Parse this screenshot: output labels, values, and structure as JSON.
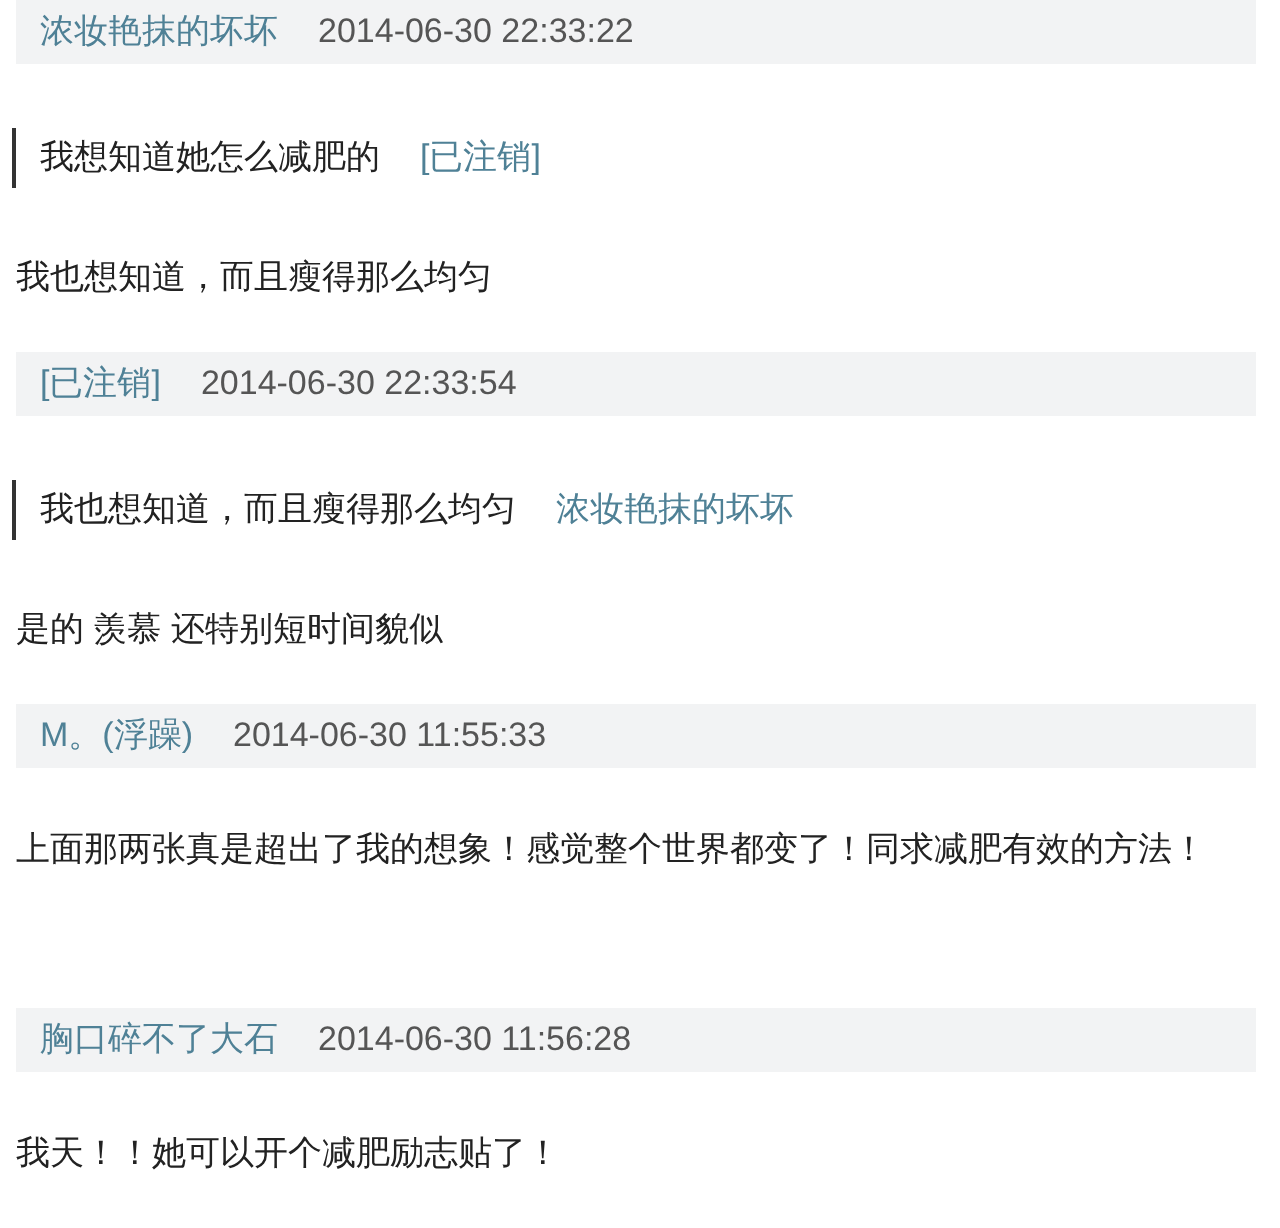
{
  "posts": [
    {
      "author": "浓妆艳抹的坏坏",
      "time": "2014-06-30 22:33:22",
      "quote": {
        "text": "我想知道她怎么减肥的",
        "author": "[已注销]"
      },
      "body": "我也想知道，而且瘦得那么均匀"
    },
    {
      "author": "[已注销]",
      "time": "2014-06-30 22:33:54",
      "quote": {
        "text": "我也想知道，而且瘦得那么均匀",
        "author": "浓妆艳抹的坏坏"
      },
      "body": "是的 羡慕 还特别短时间貌似"
    },
    {
      "author": "M。(浮躁)",
      "time": "2014-06-30 11:55:33",
      "body": "上面那两张真是超出了我的想象！感觉整个世界都变了！同求减肥有效的方法！"
    },
    {
      "author": "胸口碎不了大石",
      "time": "2014-06-30 11:56:28",
      "body": "我天！！她可以开个减肥励志贴了！"
    }
  ]
}
